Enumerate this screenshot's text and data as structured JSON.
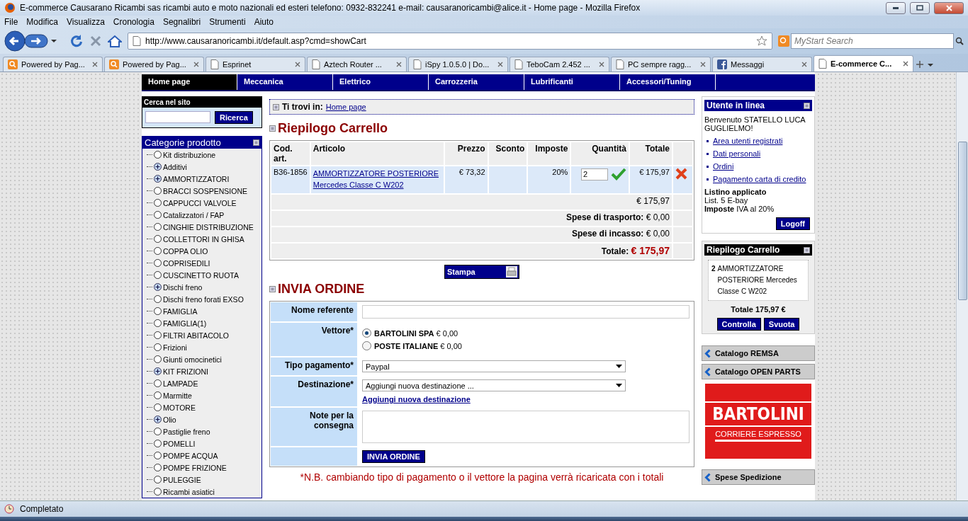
{
  "window": {
    "title": "E-commerce Causarano Ricambi sas ricambi auto e moto nazionali ed esteri telefono: 0932-832241 e-mail: causaranoricambi@alice.it - Home page - Mozilla Firefox"
  },
  "menu_bar": [
    "File",
    "Modifica",
    "Visualizza",
    "Cronologia",
    "Segnalibri",
    "Strumenti",
    "Aiuto"
  ],
  "toolbar": {
    "url": "http://www.causaranoricambi.it/default.asp?cmd=showCart",
    "search_placeholder": "MyStart Search"
  },
  "tabs": [
    {
      "label": "Powered by Pag...",
      "selected": false,
      "kind": "search"
    },
    {
      "label": "Powered by Pag...",
      "selected": false,
      "kind": "search"
    },
    {
      "label": "Esprinet",
      "selected": false,
      "kind": "page"
    },
    {
      "label": "Aztech Router ...",
      "selected": false,
      "kind": "page"
    },
    {
      "label": "iSpy 1.0.5.0 | Do...",
      "selected": false,
      "kind": "page"
    },
    {
      "label": "TeboCam 2.452 ...",
      "selected": false,
      "kind": "page"
    },
    {
      "label": "PC sempre ragg...",
      "selected": false,
      "kind": "page"
    },
    {
      "label": "Messaggi",
      "selected": false,
      "kind": "social"
    },
    {
      "label": "E-commerce C...",
      "selected": true,
      "kind": "page"
    }
  ],
  "site_nav": [
    {
      "label": "Home page",
      "selected": true
    },
    {
      "label": "Meccanica",
      "selected": false
    },
    {
      "label": "Elettrico",
      "selected": false
    },
    {
      "label": "Carrozzeria",
      "selected": false
    },
    {
      "label": "Lubrificanti",
      "selected": false
    },
    {
      "label": "Accessori/Tuning",
      "selected": false
    }
  ],
  "site_search": {
    "title": "Cerca nel sito",
    "button": "Ricerca"
  },
  "categories": {
    "title": "Categorie prodotto",
    "items": [
      {
        "label": "Kit distribuzione",
        "kind": "leaf"
      },
      {
        "label": "Additivi",
        "kind": "group"
      },
      {
        "label": "AMMORTIZZATORI",
        "kind": "group"
      },
      {
        "label": "BRACCI SOSPENSIONE",
        "kind": "leaf"
      },
      {
        "label": "CAPPUCCI VALVOLE",
        "kind": "leaf"
      },
      {
        "label": "Catalizzatori / FAP",
        "kind": "leaf"
      },
      {
        "label": "CINGHIE DISTRIBUZIONE",
        "kind": "leaf"
      },
      {
        "label": "COLLETTORI IN GHISA",
        "kind": "leaf"
      },
      {
        "label": "COPPA OLIO",
        "kind": "leaf"
      },
      {
        "label": "COPRISEDILI",
        "kind": "leaf"
      },
      {
        "label": "CUSCINETTO RUOTA",
        "kind": "leaf"
      },
      {
        "label": "Dischi freno",
        "kind": "group"
      },
      {
        "label": "Dischi freno forati EXSO",
        "kind": "leaf"
      },
      {
        "label": "FAMIGLIA",
        "kind": "leaf"
      },
      {
        "label": "FAMIGLIA(1)",
        "kind": "leaf"
      },
      {
        "label": "FILTRI ABITACOLO",
        "kind": "leaf"
      },
      {
        "label": "Frizioni",
        "kind": "leaf"
      },
      {
        "label": "Giunti omocinetici",
        "kind": "leaf"
      },
      {
        "label": "KIT FRIZIONI",
        "kind": "group"
      },
      {
        "label": "LAMPADE",
        "kind": "leaf"
      },
      {
        "label": "Marmitte",
        "kind": "leaf"
      },
      {
        "label": "MOTORE",
        "kind": "leaf"
      },
      {
        "label": "Olio",
        "kind": "group"
      },
      {
        "label": "Pastiglie freno",
        "kind": "leaf"
      },
      {
        "label": "POMELLI",
        "kind": "leaf"
      },
      {
        "label": "POMPE ACQUA",
        "kind": "leaf"
      },
      {
        "label": "POMPE FRIZIONE",
        "kind": "leaf"
      },
      {
        "label": "PULEGGIE",
        "kind": "leaf"
      },
      {
        "label": "Ricambi asiatici",
        "kind": "leaf"
      }
    ]
  },
  "breadcrumb": {
    "label": "Ti trovi in:",
    "link": "Home page"
  },
  "cart": {
    "title": "Riepilogo Carrello",
    "columns": [
      "Cod. art.",
      "Articolo",
      "Prezzo",
      "Sconto",
      "Imposte",
      "Quantità",
      "Totale"
    ],
    "rows": [
      {
        "code": "B36-1856",
        "article": "AMMORTIZZATORE POSTERIORE Mercedes Classe C W202",
        "price": "€ 73,32",
        "tax": "20%",
        "quantity": "2",
        "total": "€ 175,97"
      }
    ],
    "subtotal": "€ 175,97",
    "shipping": {
      "label": "Spese di trasporto:",
      "value": "€ 0,00"
    },
    "collection": {
      "label": "Spese di incasso:",
      "value": "€ 0,00"
    },
    "total": {
      "label": "Totale:",
      "value": "€ 175,97"
    },
    "print_button": "Stampa"
  },
  "order": {
    "title": "INVIA ORDINE",
    "name_label": "Nome referente",
    "carrier_label": "Vettore*",
    "carriers": [
      {
        "name": "BARTOLINI SPA",
        "price": "€ 0,00",
        "selected": true
      },
      {
        "name": "POSTE ITALIANE",
        "price": "€ 0,00",
        "selected": false
      }
    ],
    "payment_label": "Tipo pagamento*",
    "payment_value": "Paypal",
    "destination_label": "Destinazione*",
    "destination_value": "Aggiungi nuova destinazione ...",
    "destination_link": "Aggiungi nuova destinazione",
    "notes_label": "Note per la consegna",
    "submit": "INVIA ORDINE",
    "note": "*N.B. cambiando tipo di pagamento o il vettore la pagina verrà ricaricata con i totali"
  },
  "user_panel": {
    "title": "Utente in linea",
    "welcome": "Benvenuto STATELLO LUCA GUGLIELMO!",
    "links": [
      "Area utenti registrati",
      "Dati personali",
      "Ordini",
      "Pagamento carta di credito"
    ],
    "price_list_label": "Listino applicato",
    "price_list_value": "List. 5 E-bay",
    "tax_label": "Imposte",
    "tax_value": "IVA al 20%",
    "logoff": "Logoff"
  },
  "mini_cart": {
    "title": "Riepilogo Carrello",
    "quantity": "2",
    "item": "AMMORTIZZATORE POSTERIORE Mercedes Classe C W202",
    "total": "Totale 175,97 €",
    "buttons": [
      "Controlla",
      "Svuota"
    ]
  },
  "side_links": [
    {
      "label": "Catalogo REMSA",
      "kind": "link"
    },
    {
      "label": "Catalogo OPEN PARTS",
      "kind": "link"
    },
    {
      "label": "BARTOLINI",
      "sub": "CORRIERE ESPRESSO",
      "kind": "banner"
    },
    {
      "label": "Spese Spedizione",
      "kind": "link"
    }
  ],
  "status_bar": {
    "text": "Completato"
  }
}
